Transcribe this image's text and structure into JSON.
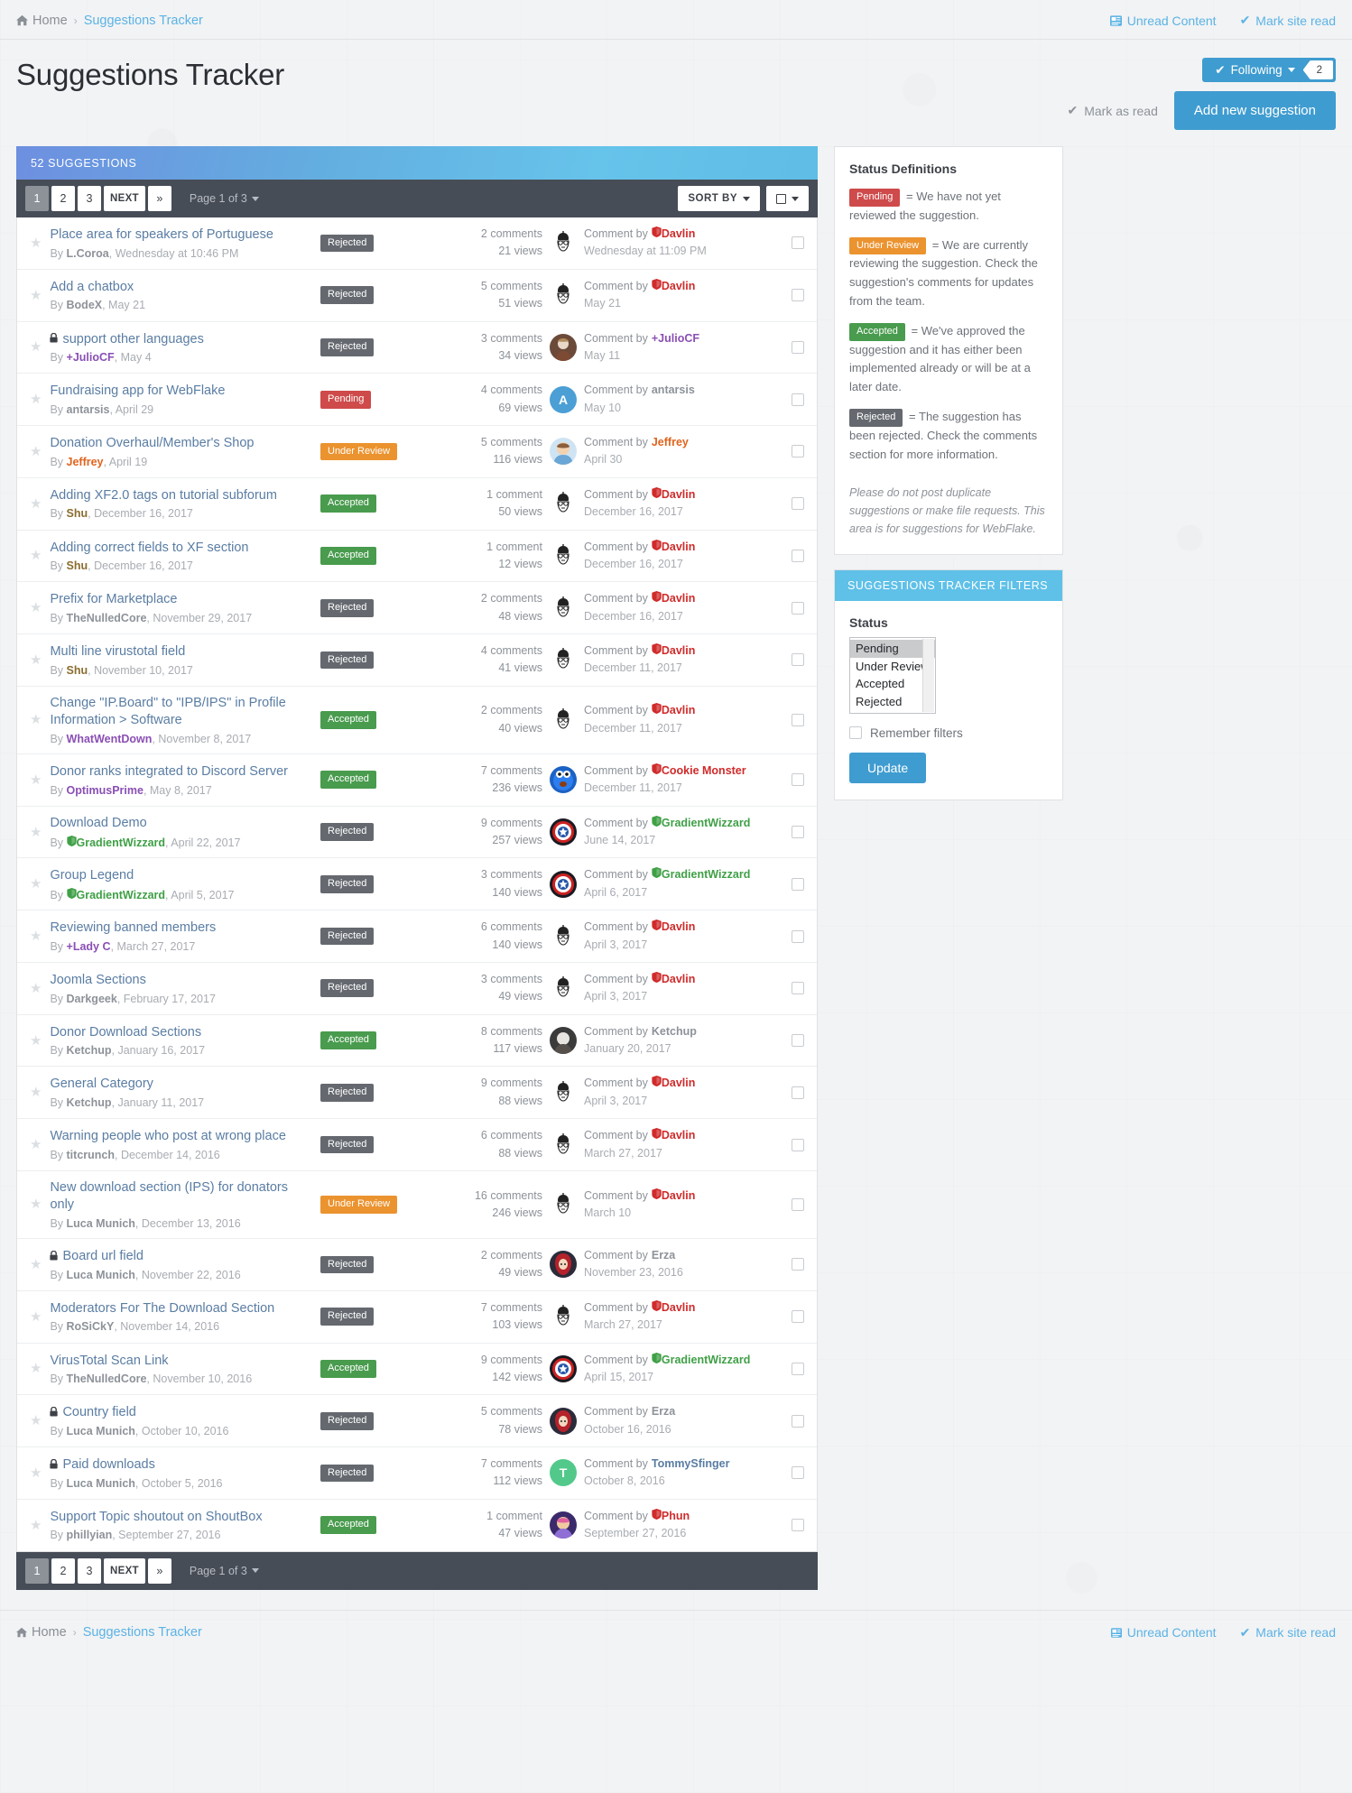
{
  "breadcrumb": {
    "home": "Home",
    "separator": "›",
    "current": "Suggestions Tracker"
  },
  "toplinks": {
    "unread": "Unread Content",
    "mark_site_read": "Mark site read"
  },
  "header": {
    "title": "Suggestions Tracker",
    "follow_label": "Following",
    "follow_count": "2",
    "mark_as_read": "Mark as read",
    "add_new": "Add new suggestion"
  },
  "list": {
    "block_title": "52 SUGGESTIONS",
    "pager": {
      "pages": [
        "1",
        "2",
        "3"
      ],
      "next": "NEXT",
      "last": "»",
      "page_of": "Page 1 of 3"
    },
    "sort_by": "SORT BY",
    "rows": [
      {
        "title": "Place area for speakers of Portuguese",
        "locked": false,
        "by": "L.Coroa",
        "by_color": "#8d9299",
        "by_prefix": "",
        "date": "Wednesday at 10:46 PM",
        "status": "Rejected",
        "status_class": "b-rejected",
        "comments": "2 comments",
        "views": "21 views",
        "last_user": "Davlin",
        "last_user_color": "#d02b2b",
        "last_shield": "red",
        "last_date": "Wednesday at 11:09 PM",
        "avatar": "davlin"
      },
      {
        "title": "Add a chatbox",
        "locked": false,
        "by": "BodeX",
        "by_color": "#8d9299",
        "by_prefix": "",
        "date": "May 21",
        "status": "Rejected",
        "status_class": "b-rejected",
        "comments": "5 comments",
        "views": "51 views",
        "last_user": "Davlin",
        "last_user_color": "#d02b2b",
        "last_shield": "red",
        "last_date": "May 21",
        "avatar": "davlin"
      },
      {
        "title": "support other languages",
        "locked": true,
        "by": "JulioCF",
        "by_color": "#8a4fb5",
        "by_prefix": "+",
        "date": "May 4",
        "status": "Rejected",
        "status_class": "b-rejected",
        "comments": "3 comments",
        "views": "34 views",
        "last_user": "JulioCF",
        "last_user_color": "#8a4fb5",
        "last_shield": "",
        "last_prefix": "+",
        "last_date": "May 11",
        "avatar": "julio"
      },
      {
        "title": "Fundraising app for WebFlake",
        "locked": false,
        "by": "antarsis",
        "by_color": "#8d9299",
        "by_prefix": "",
        "date": "April 29",
        "status": "Pending",
        "status_class": "b-pending",
        "comments": "4 comments",
        "views": "69 views",
        "last_user": "antarsis",
        "last_user_color": "#8d9299",
        "last_shield": "",
        "last_date": "May 10",
        "avatar": "letterA"
      },
      {
        "title": "Donation Overhaul/Member's Shop",
        "locked": false,
        "by": "Jeffrey",
        "by_color": "#e0641e",
        "by_prefix": "",
        "date": "April 19",
        "status": "Under Review",
        "status_class": "b-review",
        "comments": "5 comments",
        "views": "116 views",
        "last_user": "Jeffrey",
        "last_user_color": "#e0641e",
        "last_shield": "",
        "last_date": "April 30",
        "avatar": "jeffrey"
      },
      {
        "title": "Adding XF2.0 tags on tutorial subforum",
        "locked": false,
        "by": "Shu",
        "by_color": "#8a6d2f",
        "by_prefix": "",
        "date": "December 16, 2017",
        "status": "Accepted",
        "status_class": "b-accepted",
        "comments": "1 comment",
        "views": "50 views",
        "last_user": "Davlin",
        "last_user_color": "#d02b2b",
        "last_shield": "red",
        "last_date": "December 16, 2017",
        "avatar": "davlin"
      },
      {
        "title": "Adding correct fields to XF section",
        "locked": false,
        "by": "Shu",
        "by_color": "#8a6d2f",
        "by_prefix": "",
        "date": "December 16, 2017",
        "status": "Accepted",
        "status_class": "b-accepted",
        "comments": "1 comment",
        "views": "12 views",
        "last_user": "Davlin",
        "last_user_color": "#d02b2b",
        "last_shield": "red",
        "last_date": "December 16, 2017",
        "avatar": "davlin"
      },
      {
        "title": "Prefix for Marketplace",
        "locked": false,
        "by": "TheNulledCore",
        "by_color": "#8d9299",
        "by_prefix": "",
        "date": "November 29, 2017",
        "status": "Rejected",
        "status_class": "b-rejected",
        "comments": "2 comments",
        "views": "48 views",
        "last_user": "Davlin",
        "last_user_color": "#d02b2b",
        "last_shield": "red",
        "last_date": "December 16, 2017",
        "avatar": "davlin"
      },
      {
        "title": "Multi line virustotal field",
        "locked": false,
        "by": "Shu",
        "by_color": "#8a6d2f",
        "by_prefix": "",
        "date": "November 10, 2017",
        "status": "Rejected",
        "status_class": "b-rejected",
        "comments": "4 comments",
        "views": "41 views",
        "last_user": "Davlin",
        "last_user_color": "#d02b2b",
        "last_shield": "red",
        "last_date": "December 11, 2017",
        "avatar": "davlin"
      },
      {
        "title": "Change \"IP.Board\" to \"IPB/IPS\" in Profile Information > Software",
        "locked": false,
        "by": "WhatWentDown",
        "by_color": "#8a4fb5",
        "by_prefix": "",
        "date": "November 8, 2017",
        "status": "Accepted",
        "status_class": "b-accepted",
        "comments": "2 comments",
        "views": "40 views",
        "last_user": "Davlin",
        "last_user_color": "#d02b2b",
        "last_shield": "red",
        "last_date": "December 11, 2017",
        "avatar": "davlin"
      },
      {
        "title": "Donor ranks integrated to Discord Server",
        "locked": false,
        "by": "OptimusPrime",
        "by_color": "#8a4fb5",
        "by_prefix": "",
        "date": "May 8, 2017",
        "status": "Accepted",
        "status_class": "b-accepted",
        "comments": "7 comments",
        "views": "236 views",
        "last_user": "Cookie Monster",
        "last_user_color": "#d02b2b",
        "last_shield": "red",
        "last_date": "December 11, 2017",
        "avatar": "cookie"
      },
      {
        "title": "Download Demo",
        "locked": false,
        "by": "GradientWizzard",
        "by_color": "#3fa046",
        "by_prefix": "",
        "by_shield": "green",
        "date": "April 22, 2017",
        "status": "Rejected",
        "status_class": "b-rejected",
        "comments": "9 comments",
        "views": "257 views",
        "last_user": "GradientWizzard",
        "last_user_color": "#3fa046",
        "last_shield": "green",
        "last_date": "June 14, 2017",
        "avatar": "shield"
      },
      {
        "title": "Group Legend",
        "locked": false,
        "by": "GradientWizzard",
        "by_color": "#3fa046",
        "by_prefix": "",
        "by_shield": "green",
        "date": "April 5, 2017",
        "status": "Rejected",
        "status_class": "b-rejected",
        "comments": "3 comments",
        "views": "140 views",
        "last_user": "GradientWizzard",
        "last_user_color": "#3fa046",
        "last_shield": "green",
        "last_date": "April 6, 2017",
        "avatar": "shield"
      },
      {
        "title": "Reviewing banned members",
        "locked": false,
        "by": "Lady C",
        "by_color": "#8a4fb5",
        "by_prefix": "+",
        "date": "March 27, 2017",
        "status": "Rejected",
        "status_class": "b-rejected",
        "comments": "6 comments",
        "views": "140 views",
        "last_user": "Davlin",
        "last_user_color": "#d02b2b",
        "last_shield": "red",
        "last_date": "April 3, 2017",
        "avatar": "davlin"
      },
      {
        "title": "Joomla Sections",
        "locked": false,
        "by": "Darkgeek",
        "by_color": "#8d9299",
        "by_prefix": "",
        "date": "February 17, 2017",
        "status": "Rejected",
        "status_class": "b-rejected",
        "comments": "3 comments",
        "views": "49 views",
        "last_user": "Davlin",
        "last_user_color": "#d02b2b",
        "last_shield": "red",
        "last_date": "April 3, 2017",
        "avatar": "davlin"
      },
      {
        "title": "Donor Download Sections",
        "locked": false,
        "by": "Ketchup",
        "by_color": "#8d9299",
        "by_prefix": "",
        "date": "January 16, 2017",
        "status": "Accepted",
        "status_class": "b-accepted",
        "comments": "8 comments",
        "views": "117 views",
        "last_user": "Ketchup",
        "last_user_color": "#8d9299",
        "last_shield": "",
        "last_date": "January 20, 2017",
        "avatar": "ketchup"
      },
      {
        "title": "General Category",
        "locked": false,
        "by": "Ketchup",
        "by_color": "#8d9299",
        "by_prefix": "",
        "date": "January 11, 2017",
        "status": "Rejected",
        "status_class": "b-rejected",
        "comments": "9 comments",
        "views": "88 views",
        "last_user": "Davlin",
        "last_user_color": "#d02b2b",
        "last_shield": "red",
        "last_date": "April 3, 2017",
        "avatar": "davlin"
      },
      {
        "title": "Warning people who post at wrong place",
        "locked": false,
        "by": "titcrunch",
        "by_color": "#8d9299",
        "by_prefix": "",
        "date": "December 14, 2016",
        "status": "Rejected",
        "status_class": "b-rejected",
        "comments": "6 comments",
        "views": "88 views",
        "last_user": "Davlin",
        "last_user_color": "#d02b2b",
        "last_shield": "red",
        "last_date": "March 27, 2017",
        "avatar": "davlin"
      },
      {
        "title": "New download section (IPS) for donators only",
        "locked": false,
        "by": "Luca Munich",
        "by_color": "#8d9299",
        "by_prefix": "",
        "date": "December 13, 2016",
        "status": "Under Review",
        "status_class": "b-review",
        "comments": "16 comments",
        "views": "246 views",
        "last_user": "Davlin",
        "last_user_color": "#d02b2b",
        "last_shield": "red",
        "last_date": "March 10",
        "avatar": "davlin"
      },
      {
        "title": "Board url field",
        "locked": true,
        "by": "Luca Munich",
        "by_color": "#8d9299",
        "by_prefix": "",
        "date": "November 22, 2016",
        "status": "Rejected",
        "status_class": "b-rejected",
        "comments": "2 comments",
        "views": "49 views",
        "last_user": "Erza",
        "last_user_color": "#8d9299",
        "last_shield": "",
        "last_date": "November 23, 2016",
        "avatar": "erza"
      },
      {
        "title": "Moderators For The Download Section",
        "locked": false,
        "by": "RoSiCkY",
        "by_color": "#8d9299",
        "by_prefix": "",
        "date": "November 14, 2016",
        "status": "Rejected",
        "status_class": "b-rejected",
        "comments": "7 comments",
        "views": "103 views",
        "last_user": "Davlin",
        "last_user_color": "#d02b2b",
        "last_shield": "red",
        "last_date": "March 27, 2017",
        "avatar": "davlin"
      },
      {
        "title": "VirusTotal Scan Link",
        "locked": false,
        "by": "TheNulledCore",
        "by_color": "#8d9299",
        "by_prefix": "",
        "date": "November 10, 2016",
        "status": "Accepted",
        "status_class": "b-accepted",
        "comments": "9 comments",
        "views": "142 views",
        "last_user": "GradientWizzard",
        "last_user_color": "#3fa046",
        "last_shield": "green",
        "last_date": "April 15, 2017",
        "avatar": "shield"
      },
      {
        "title": "Country field",
        "locked": true,
        "by": "Luca Munich",
        "by_color": "#8d9299",
        "by_prefix": "",
        "date": "October 10, 2016",
        "status": "Rejected",
        "status_class": "b-rejected",
        "comments": "5 comments",
        "views": "78 views",
        "last_user": "Erza",
        "last_user_color": "#8d9299",
        "last_shield": "",
        "last_date": "October 16, 2016",
        "avatar": "erza"
      },
      {
        "title": "Paid downloads",
        "locked": true,
        "by": "Luca Munich",
        "by_color": "#8d9299",
        "by_prefix": "",
        "date": "October 5, 2016",
        "status": "Rejected",
        "status_class": "b-rejected",
        "comments": "7 comments",
        "views": "112 views",
        "last_user": "TommySfinger",
        "last_user_color": "#5a7da3",
        "last_shield": "",
        "last_date": "October 8, 2016",
        "avatar": "letterT"
      },
      {
        "title": "Support Topic shoutout on ShoutBox",
        "locked": false,
        "by": "phillyian",
        "by_color": "#8d9299",
        "by_prefix": "",
        "date": "September 27, 2016",
        "status": "Accepted",
        "status_class": "b-accepted",
        "comments": "1 comment",
        "views": "47 views",
        "last_user": "Phun",
        "last_user_color": "#d02b2b",
        "last_shield": "red",
        "last_date": "September 27, 2016",
        "avatar": "phun"
      }
    ]
  },
  "sidebar": {
    "status_definitions": {
      "heading": "Status Definitions",
      "items": [
        {
          "badge": "Pending",
          "badge_class": "b-pending",
          "text": "= We have not yet reviewed the suggestion."
        },
        {
          "badge": "Under Review",
          "badge_class": "b-review",
          "text": "= We are currently reviewing the suggestion. Check the suggestion's comments for updates from the team."
        },
        {
          "badge": "Accepted",
          "badge_class": "b-accepted",
          "text": "= We've approved the suggestion and it has either been implemented already or will be at a later date."
        },
        {
          "badge": "Rejected",
          "badge_class": "b-rejected",
          "text": "= The suggestion has been rejected. Check the comments section for more information."
        }
      ],
      "note": "Please do not post duplicate suggestions or make file requests. This area is for suggestions for WebFlake."
    },
    "filters": {
      "title": "SUGGESTIONS TRACKER FILTERS",
      "status_label": "Status",
      "options": [
        "Pending",
        "Under Review",
        "Accepted",
        "Rejected"
      ],
      "selected": "Pending",
      "remember_label": "Remember filters",
      "update_label": "Update"
    }
  },
  "colors": {
    "accent": "#3f9cd0",
    "panel_header": "#5fc0e8",
    "toolbar": "#474d57"
  }
}
